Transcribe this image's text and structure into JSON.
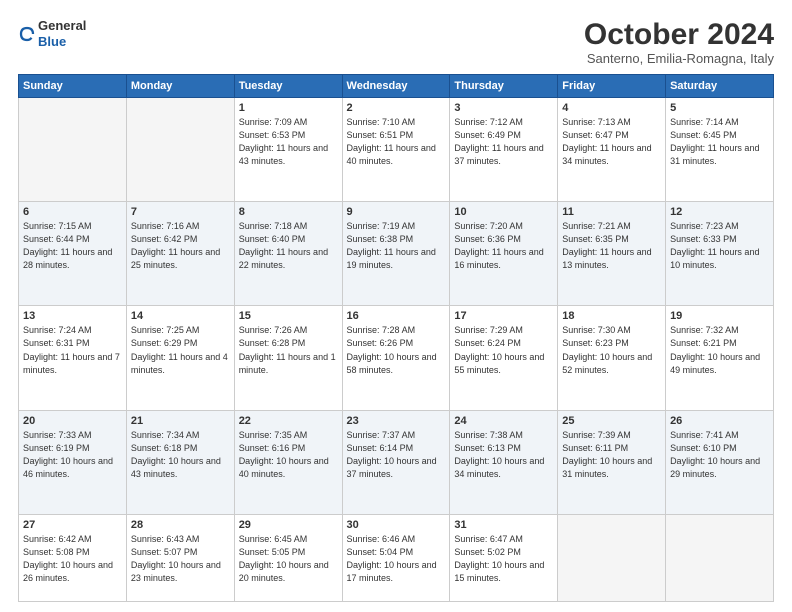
{
  "header": {
    "logo_line1": "General",
    "logo_line2": "Blue",
    "month": "October 2024",
    "location": "Santerno, Emilia-Romagna, Italy"
  },
  "weekdays": [
    "Sunday",
    "Monday",
    "Tuesday",
    "Wednesday",
    "Thursday",
    "Friday",
    "Saturday"
  ],
  "weeks": [
    [
      {
        "day": "",
        "sunrise": "",
        "sunset": "",
        "daylight": ""
      },
      {
        "day": "",
        "sunrise": "",
        "sunset": "",
        "daylight": ""
      },
      {
        "day": "1",
        "sunrise": "Sunrise: 7:09 AM",
        "sunset": "Sunset: 6:53 PM",
        "daylight": "Daylight: 11 hours and 43 minutes."
      },
      {
        "day": "2",
        "sunrise": "Sunrise: 7:10 AM",
        "sunset": "Sunset: 6:51 PM",
        "daylight": "Daylight: 11 hours and 40 minutes."
      },
      {
        "day": "3",
        "sunrise": "Sunrise: 7:12 AM",
        "sunset": "Sunset: 6:49 PM",
        "daylight": "Daylight: 11 hours and 37 minutes."
      },
      {
        "day": "4",
        "sunrise": "Sunrise: 7:13 AM",
        "sunset": "Sunset: 6:47 PM",
        "daylight": "Daylight: 11 hours and 34 minutes."
      },
      {
        "day": "5",
        "sunrise": "Sunrise: 7:14 AM",
        "sunset": "Sunset: 6:45 PM",
        "daylight": "Daylight: 11 hours and 31 minutes."
      }
    ],
    [
      {
        "day": "6",
        "sunrise": "Sunrise: 7:15 AM",
        "sunset": "Sunset: 6:44 PM",
        "daylight": "Daylight: 11 hours and 28 minutes."
      },
      {
        "day": "7",
        "sunrise": "Sunrise: 7:16 AM",
        "sunset": "Sunset: 6:42 PM",
        "daylight": "Daylight: 11 hours and 25 minutes."
      },
      {
        "day": "8",
        "sunrise": "Sunrise: 7:18 AM",
        "sunset": "Sunset: 6:40 PM",
        "daylight": "Daylight: 11 hours and 22 minutes."
      },
      {
        "day": "9",
        "sunrise": "Sunrise: 7:19 AM",
        "sunset": "Sunset: 6:38 PM",
        "daylight": "Daylight: 11 hours and 19 minutes."
      },
      {
        "day": "10",
        "sunrise": "Sunrise: 7:20 AM",
        "sunset": "Sunset: 6:36 PM",
        "daylight": "Daylight: 11 hours and 16 minutes."
      },
      {
        "day": "11",
        "sunrise": "Sunrise: 7:21 AM",
        "sunset": "Sunset: 6:35 PM",
        "daylight": "Daylight: 11 hours and 13 minutes."
      },
      {
        "day": "12",
        "sunrise": "Sunrise: 7:23 AM",
        "sunset": "Sunset: 6:33 PM",
        "daylight": "Daylight: 11 hours and 10 minutes."
      }
    ],
    [
      {
        "day": "13",
        "sunrise": "Sunrise: 7:24 AM",
        "sunset": "Sunset: 6:31 PM",
        "daylight": "Daylight: 11 hours and 7 minutes."
      },
      {
        "day": "14",
        "sunrise": "Sunrise: 7:25 AM",
        "sunset": "Sunset: 6:29 PM",
        "daylight": "Daylight: 11 hours and 4 minutes."
      },
      {
        "day": "15",
        "sunrise": "Sunrise: 7:26 AM",
        "sunset": "Sunset: 6:28 PM",
        "daylight": "Daylight: 11 hours and 1 minute."
      },
      {
        "day": "16",
        "sunrise": "Sunrise: 7:28 AM",
        "sunset": "Sunset: 6:26 PM",
        "daylight": "Daylight: 10 hours and 58 minutes."
      },
      {
        "day": "17",
        "sunrise": "Sunrise: 7:29 AM",
        "sunset": "Sunset: 6:24 PM",
        "daylight": "Daylight: 10 hours and 55 minutes."
      },
      {
        "day": "18",
        "sunrise": "Sunrise: 7:30 AM",
        "sunset": "Sunset: 6:23 PM",
        "daylight": "Daylight: 10 hours and 52 minutes."
      },
      {
        "day": "19",
        "sunrise": "Sunrise: 7:32 AM",
        "sunset": "Sunset: 6:21 PM",
        "daylight": "Daylight: 10 hours and 49 minutes."
      }
    ],
    [
      {
        "day": "20",
        "sunrise": "Sunrise: 7:33 AM",
        "sunset": "Sunset: 6:19 PM",
        "daylight": "Daylight: 10 hours and 46 minutes."
      },
      {
        "day": "21",
        "sunrise": "Sunrise: 7:34 AM",
        "sunset": "Sunset: 6:18 PM",
        "daylight": "Daylight: 10 hours and 43 minutes."
      },
      {
        "day": "22",
        "sunrise": "Sunrise: 7:35 AM",
        "sunset": "Sunset: 6:16 PM",
        "daylight": "Daylight: 10 hours and 40 minutes."
      },
      {
        "day": "23",
        "sunrise": "Sunrise: 7:37 AM",
        "sunset": "Sunset: 6:14 PM",
        "daylight": "Daylight: 10 hours and 37 minutes."
      },
      {
        "day": "24",
        "sunrise": "Sunrise: 7:38 AM",
        "sunset": "Sunset: 6:13 PM",
        "daylight": "Daylight: 10 hours and 34 minutes."
      },
      {
        "day": "25",
        "sunrise": "Sunrise: 7:39 AM",
        "sunset": "Sunset: 6:11 PM",
        "daylight": "Daylight: 10 hours and 31 minutes."
      },
      {
        "day": "26",
        "sunrise": "Sunrise: 7:41 AM",
        "sunset": "Sunset: 6:10 PM",
        "daylight": "Daylight: 10 hours and 29 minutes."
      }
    ],
    [
      {
        "day": "27",
        "sunrise": "Sunrise: 6:42 AM",
        "sunset": "Sunset: 5:08 PM",
        "daylight": "Daylight: 10 hours and 26 minutes."
      },
      {
        "day": "28",
        "sunrise": "Sunrise: 6:43 AM",
        "sunset": "Sunset: 5:07 PM",
        "daylight": "Daylight: 10 hours and 23 minutes."
      },
      {
        "day": "29",
        "sunrise": "Sunrise: 6:45 AM",
        "sunset": "Sunset: 5:05 PM",
        "daylight": "Daylight: 10 hours and 20 minutes."
      },
      {
        "day": "30",
        "sunrise": "Sunrise: 6:46 AM",
        "sunset": "Sunset: 5:04 PM",
        "daylight": "Daylight: 10 hours and 17 minutes."
      },
      {
        "day": "31",
        "sunrise": "Sunrise: 6:47 AM",
        "sunset": "Sunset: 5:02 PM",
        "daylight": "Daylight: 10 hours and 15 minutes."
      },
      {
        "day": "",
        "sunrise": "",
        "sunset": "",
        "daylight": ""
      },
      {
        "day": "",
        "sunrise": "",
        "sunset": "",
        "daylight": ""
      }
    ]
  ]
}
